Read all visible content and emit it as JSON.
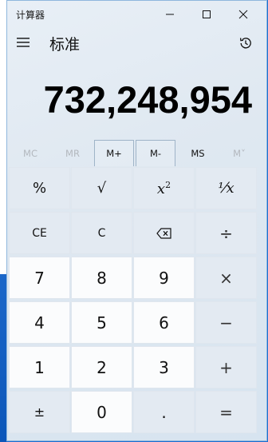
{
  "window": {
    "title": "计算器"
  },
  "header": {
    "mode_title": "标准"
  },
  "display": {
    "value": "732,248,954"
  },
  "memory": {
    "buttons": [
      {
        "label": "MC",
        "enabled": false
      },
      {
        "label": "MR",
        "enabled": false
      },
      {
        "label": "M+",
        "enabled": true
      },
      {
        "label": "M-",
        "enabled": true
      },
      {
        "label": "MS",
        "enabled": true
      },
      {
        "label": "M˅",
        "enabled": false
      }
    ]
  },
  "keys": {
    "percent": "%",
    "sqrt": "√",
    "square": "x",
    "square_sup": "2",
    "reciprocal": "⅟x",
    "ce": "CE",
    "c": "C",
    "divide": "÷",
    "multiply": "×",
    "minus": "−",
    "plus": "+",
    "equals": "=",
    "plus_minus": "±",
    "decimal": ".",
    "d0": "0",
    "d1": "1",
    "d2": "2",
    "d3": "3",
    "d4": "4",
    "d5": "5",
    "d6": "6",
    "d7": "7",
    "d8": "8",
    "d9": "9"
  },
  "icons": {
    "menu": "hamburger-menu-icon",
    "history": "history-icon",
    "backspace": "backspace-icon",
    "minimize": "minimize-icon",
    "maximize": "maximize-icon",
    "close": "close-icon"
  }
}
